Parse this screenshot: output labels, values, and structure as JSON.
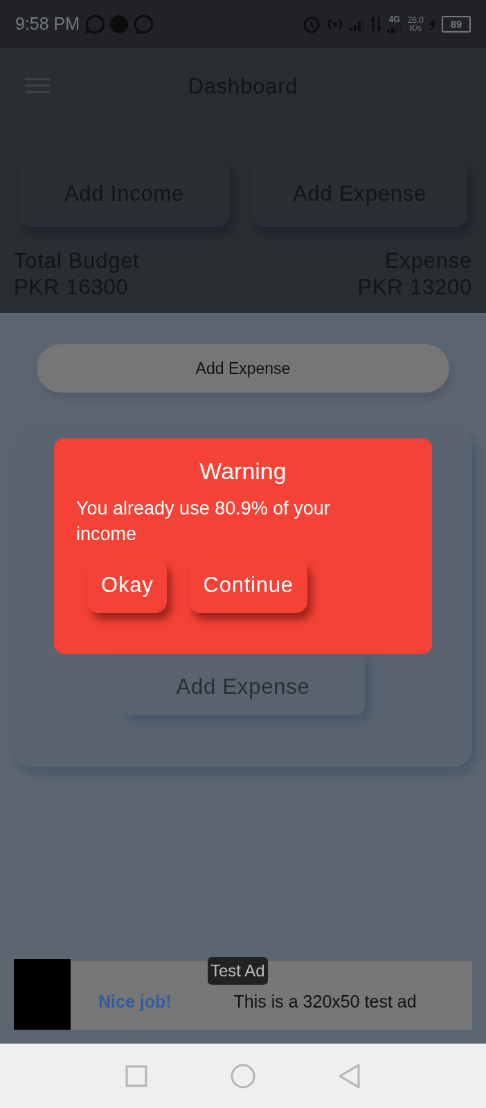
{
  "status_bar": {
    "time": "9:58 PM",
    "network": "4G",
    "speed": "26.0",
    "speed_unit": "K/s",
    "battery": "89"
  },
  "app_bar": {
    "title": "Dashboard"
  },
  "actions": [
    "Add Income",
    "Add Expense"
  ],
  "summary": [
    {
      "label": "Total Budget",
      "amount": "PKR 16300"
    },
    {
      "label": "Expense",
      "amount": "PKR 13200"
    }
  ],
  "sheet": {
    "top_button": "Add Expense",
    "submit_button": "Add Expense"
  },
  "dialog": {
    "title": "Warning",
    "message": "You already use 80.9% of your income",
    "buttons": [
      "Okay",
      "Continue"
    ]
  },
  "ad": {
    "badge": "Test Ad",
    "headline": "Nice job!",
    "text": "This is a 320x50 test ad"
  }
}
